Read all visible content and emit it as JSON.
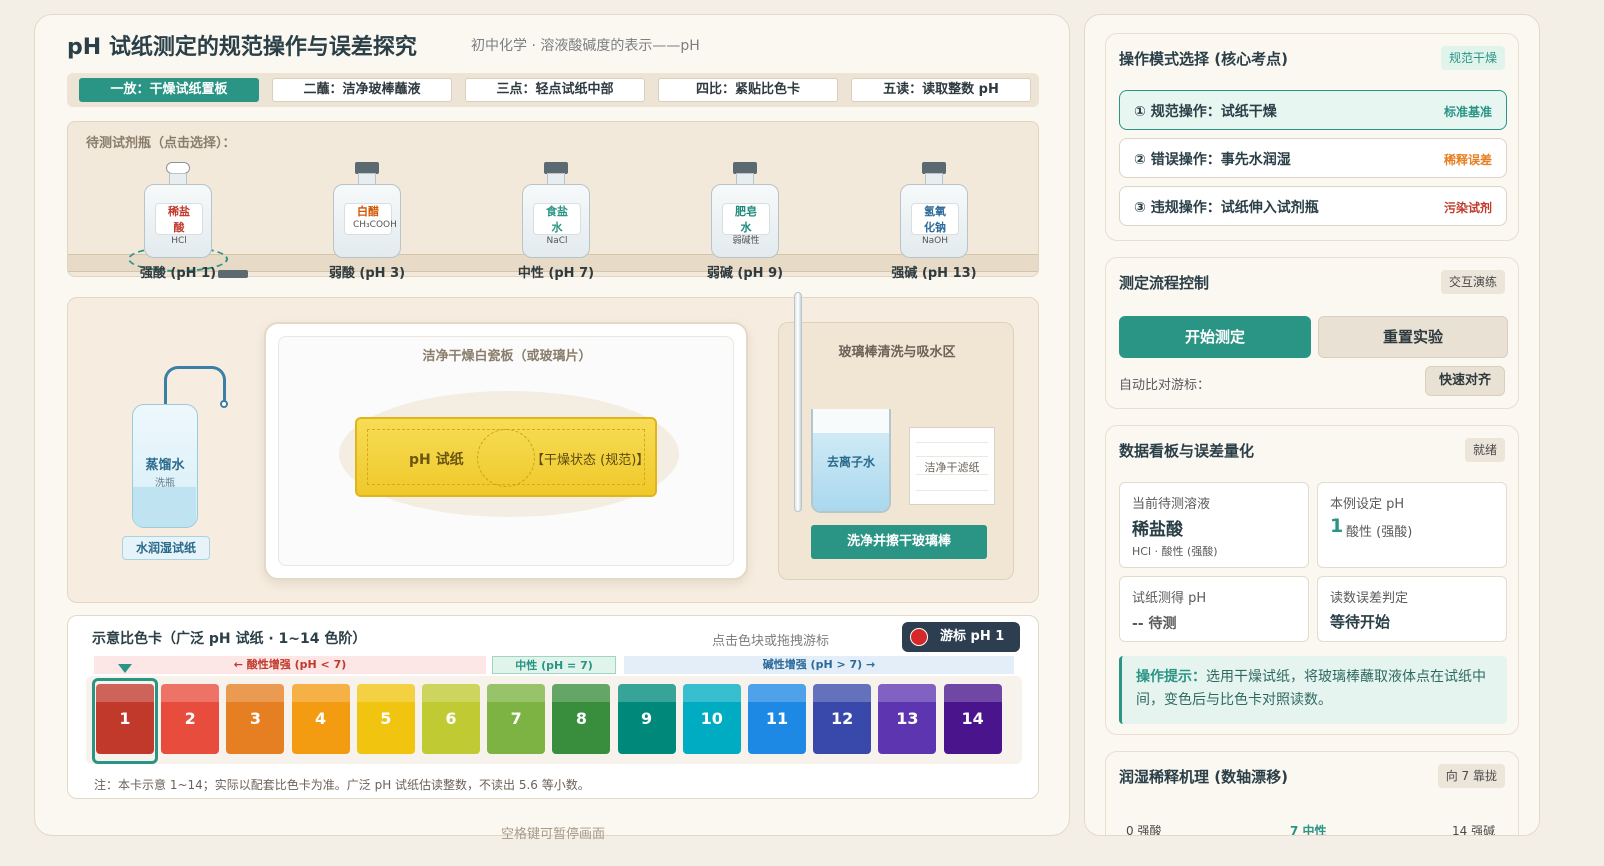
{
  "header": {
    "title": "pH 试纸测定的规范操作与误差探究",
    "subtitle": "初中化学 · 溶液酸碱度的表示——pH"
  },
  "steps": [
    {
      "label": "一放：干燥试纸置板",
      "active": true
    },
    {
      "label": "二蘸：洁净玻棒蘸液",
      "active": false
    },
    {
      "label": "三点：轻点试纸中部",
      "active": false
    },
    {
      "label": "四比：紧贴比色卡",
      "active": false
    },
    {
      "label": "五读：读取整数 pH",
      "active": false
    }
  ],
  "shelf": {
    "label": "待测试剂瓶（点击选择）：",
    "bottles": [
      {
        "name": "稀盐酸",
        "formula": "HCl",
        "caption": "强酸 (pH 1)",
        "color": "#c0392b",
        "selected": true
      },
      {
        "name": "白醋",
        "formula": "CH₃COOH",
        "caption": "弱酸 (pH 3)",
        "color": "#d35400",
        "selected": false
      },
      {
        "name": "食盐水",
        "formula": "NaCl",
        "caption": "中性 (pH 7)",
        "color": "#2a9485",
        "selected": false
      },
      {
        "name": "肥皂水",
        "formula": "弱碱性",
        "caption": "弱碱 (pH 9)",
        "color": "#1e8a7a",
        "selected": false
      },
      {
        "name": "氢氧化钠",
        "formula": "NaOH",
        "caption": "强碱 (pH 13)",
        "color": "#2b6a9a",
        "selected": false
      }
    ]
  },
  "bench": {
    "wash_bottle_name": "蒸馏水",
    "wash_bottle_sub": "洗瓶",
    "wash_button": "水润湿试纸",
    "tile_title": "洁净干燥白瓷板（或玻璃片）",
    "strip_name": "pH 试纸",
    "strip_status": "【干燥状态 (规范)】",
    "rinse_title": "玻璃棒清洗与吸水区",
    "beaker_label": "去离子水",
    "filter_label": "洁净干滤纸",
    "rinse_button": "洗净并擦干玻璃棒"
  },
  "card": {
    "title": "示意比色卡（广泛 pH 试纸 · 1~14 色阶）",
    "hint": "点击色块或拖拽游标",
    "cursor_label": "游标 pH 1",
    "zones": {
      "acid": "← 酸性增强 (pH < 7)",
      "neutral": "中性 (pH = 7)",
      "base": "碱性增强 (pH > 7) →"
    },
    "selected_ph": 1,
    "swatches": [
      {
        "ph": "1",
        "color": "#c0392b"
      },
      {
        "ph": "2",
        "color": "#e74c3c"
      },
      {
        "ph": "3",
        "color": "#e67e22"
      },
      {
        "ph": "4",
        "color": "#f39c12"
      },
      {
        "ph": "5",
        "color": "#f1c40f"
      },
      {
        "ph": "6",
        "color": "#c0ca33"
      },
      {
        "ph": "7",
        "color": "#7cb342"
      },
      {
        "ph": "8",
        "color": "#388e3c"
      },
      {
        "ph": "9",
        "color": "#00897b"
      },
      {
        "ph": "10",
        "color": "#00acc1"
      },
      {
        "ph": "11",
        "color": "#1e88e5"
      },
      {
        "ph": "12",
        "color": "#3949ab"
      },
      {
        "ph": "13",
        "color": "#5e35b1"
      },
      {
        "ph": "14",
        "color": "#4a148c"
      }
    ],
    "note": "注：本卡示意 1~14；实际以配套比色卡为准。广泛 pH 试纸估读整数，不读出 5.6 等小数。"
  },
  "pause_hint": "空格键可暂停画面",
  "sidebar": {
    "mode": {
      "title": "操作模式选择 (核心考点)",
      "tag": "规范干燥",
      "options": [
        {
          "label": "① 规范操作：试纸干燥",
          "note": "标准基准",
          "note_color": "#2a9485",
          "active": true
        },
        {
          "label": "② 错误操作：事先水润湿",
          "note": "稀释误差",
          "note_color": "#e67e22",
          "active": false
        },
        {
          "label": "③ 违规操作：试纸伸入试剂瓶",
          "note": "污染试剂",
          "note_color": "#c0392b",
          "active": false
        }
      ]
    },
    "flow": {
      "title": "测定流程控制",
      "tag": "交互演练",
      "start": "开始测定",
      "reset": "重置实验",
      "align_label": "自动比对游标：",
      "align_button": "快速对齐"
    },
    "data": {
      "title": "数据看板与误差量化",
      "tag": "就绪",
      "current_label": "当前待测溶液",
      "current_value": "稀盐酸",
      "current_sub": "HCl · 酸性 (强酸)",
      "preset_label": "本例设定 pH",
      "preset_value": "1",
      "preset_sub": "酸性 (强酸)",
      "measured_label": "试纸测得 pH",
      "measured_value": "-- 待测",
      "judge_label": "读数误差判定",
      "judge_value": "等待开始",
      "tip_head": "操作提示：",
      "tip_body": "选用干燥试纸，将玻璃棒蘸取液体点在试纸中间，变色后与比色卡对照读数。"
    },
    "dilution": {
      "title": "润湿稀释机理 (数轴漂移)",
      "tag": "向 7 靠拢",
      "axis_left": "0 强酸",
      "axis_mid": "7 中性",
      "axis_right": "14 强碱"
    }
  }
}
